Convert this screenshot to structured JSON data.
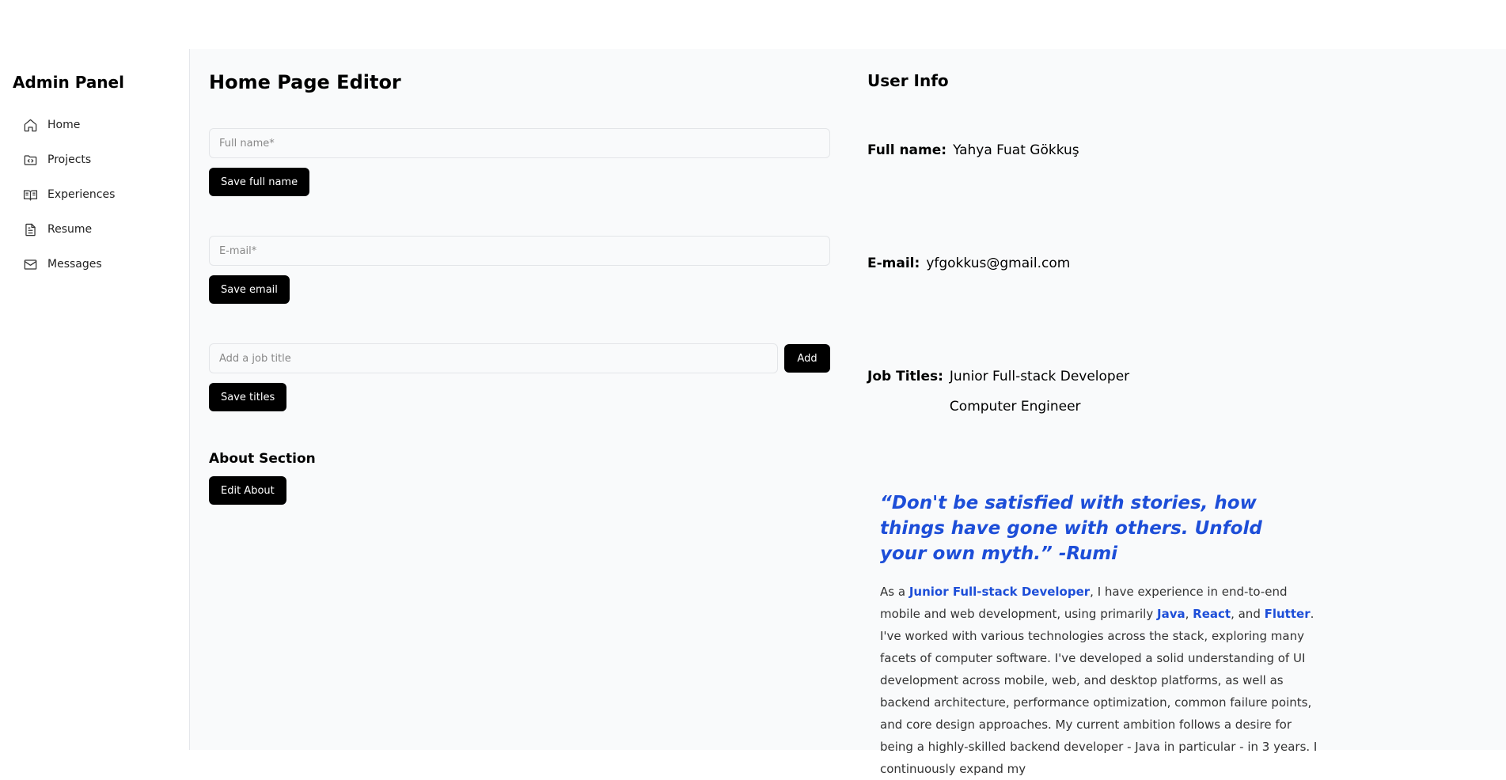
{
  "sidebar": {
    "title": "Admin Panel",
    "items": [
      {
        "label": "Home",
        "icon": "home-icon"
      },
      {
        "label": "Projects",
        "icon": "folder-code-icon"
      },
      {
        "label": "Experiences",
        "icon": "book-open-icon"
      },
      {
        "label": "Resume",
        "icon": "file-text-icon"
      },
      {
        "label": "Messages",
        "icon": "mail-icon"
      }
    ]
  },
  "editor": {
    "title": "Home Page Editor",
    "full_name_placeholder": "Full name*",
    "save_full_name": "Save full name",
    "email_placeholder": "E-mail*",
    "save_email": "Save email",
    "job_title_placeholder": "Add a job title",
    "add_label": "Add",
    "save_titles": "Save titles",
    "about_heading": "About Section",
    "edit_about": "Edit About"
  },
  "info": {
    "title": "User Info",
    "full_name_label": "Full name:",
    "full_name_value": "Yahya Fuat Gökkuş",
    "email_label": "E-mail:",
    "email_value": "yfgokkus@gmail.com",
    "job_titles_label": "Job Titles:",
    "job_titles": [
      "Junior Full-stack Developer",
      "Computer Engineer"
    ],
    "quote": "“Don't be satisfied with stories, how things have gone with others. Unfold your own myth.” -Rumi",
    "about": {
      "p1": "As a ",
      "h1": "Junior Full-stack Developer",
      "p2": ", I have experience in end-to-end mobile and web development, using primarily ",
      "h2": "Java",
      "p3": ", ",
      "h3": "React",
      "p4": ", and ",
      "h4": "Flutter",
      "p5": ". I've worked with various technologies across the stack, exploring many facets of computer software. I've developed a solid understanding of UI development across mobile, web, and desktop platforms, as well as backend architecture, performance optimization, common failure points, and core design approaches. My current ambition follows a desire for being a highly-skilled backend developer - Java in particular - in 3 years. I continuously expand my"
    }
  },
  "colors": {
    "accent": "#1d4ed8",
    "button": "#000000",
    "background": "#f9fafb"
  }
}
